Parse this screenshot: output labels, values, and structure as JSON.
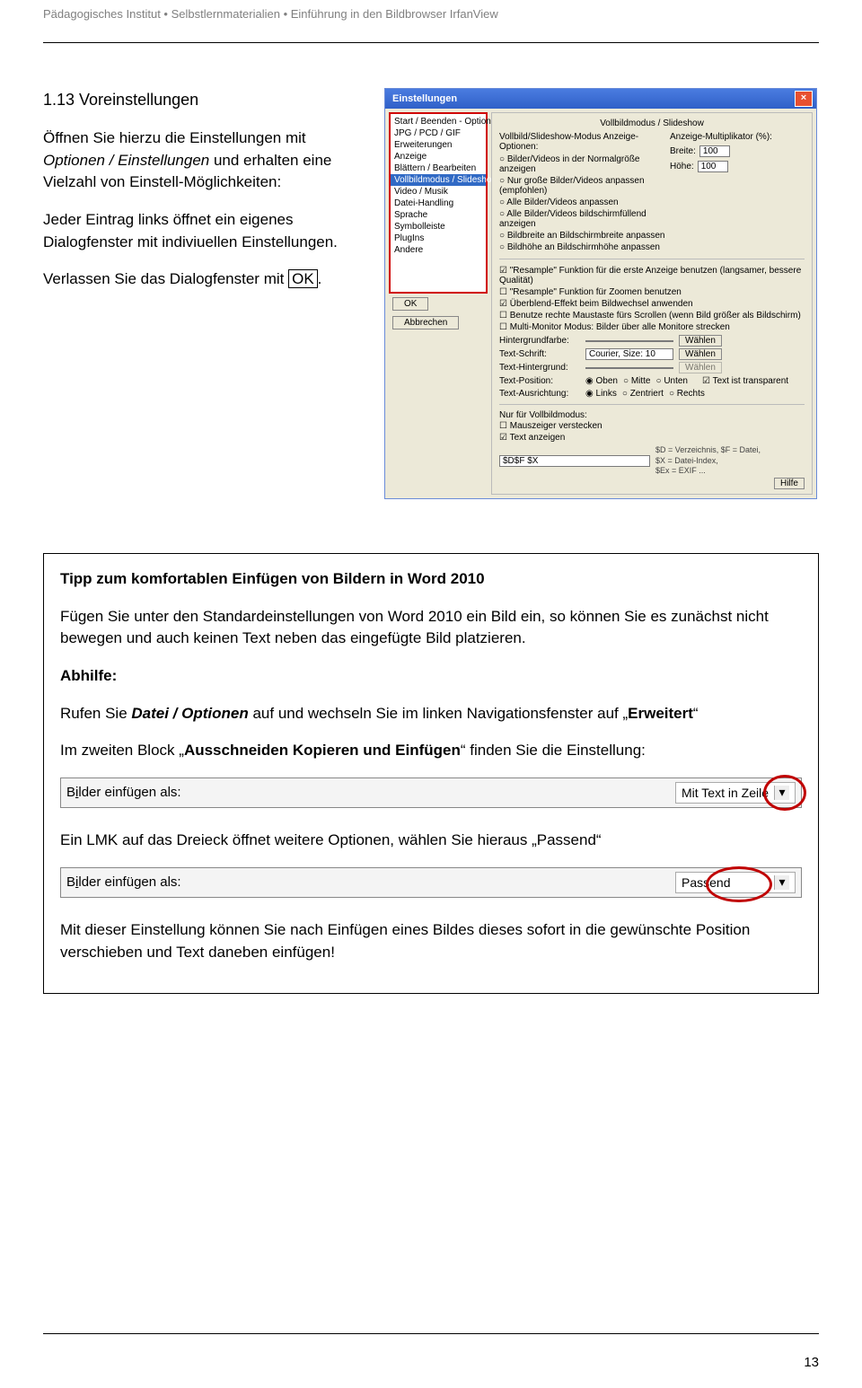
{
  "header": {
    "breadcrumb": "Pädagogisches Institut • Selbstlernmaterialien • Einführung in den Bildbrowser IrfanView"
  },
  "section": {
    "heading": "1.13 Voreinstellungen",
    "p1a": "Öffnen Sie hierzu die Einstellungen mit ",
    "p1b": "Optionen / Einstellungen",
    "p1c": " und erhalten eine Vielzahl von Einstell-Möglichkeiten:",
    "p2": "Jeder Eintrag links öffnet ein eigenes Dialogfenster mit indiviuellen Einstellungen.",
    "p3a": "Verlassen Sie das Dialogfenster mit ",
    "p3b": "OK",
    "p3c": "."
  },
  "dlg": {
    "title": "Einstellungen",
    "categories": [
      "Start / Beenden - Optionen",
      "JPG / PCD / GIF",
      "Erweiterungen",
      "Anzeige",
      "Blättern / Bearbeiten",
      "Vollbildmodus / Slideshow",
      "Video / Musik",
      "Datei-Handling",
      "Sprache",
      "Symbolleiste",
      "PlugIns",
      "Andere"
    ],
    "sel_index": 5,
    "ok": "OK",
    "cancel": "Abbrechen",
    "group": "Vollbildmodus / Slideshow",
    "left_hdr": "Vollbild/Slideshow-Modus Anzeige-Optionen:",
    "radios": [
      "Bilder/Videos in der Normalgröße anzeigen",
      "Nur große Bilder/Videos anpassen (empfohlen)",
      "Alle Bilder/Videos anpassen",
      "Alle Bilder/Videos bildschirmfüllend anzeigen",
      "Bildbreite an Bildschirmbreite anpassen",
      "Bildhöhe an Bildschirmhöhe anpassen"
    ],
    "right_hdr": "Anzeige-Multiplikator (%):",
    "breite_lbl": "Breite:",
    "breite_val": "100",
    "hoehe_lbl": "Höhe:",
    "hoehe_val": "100",
    "chk1": "\"Resample\" Funktion für die erste Anzeige benutzen (langsamer, bessere Qualität)",
    "chk2": "\"Resample\" Funktion für Zoomen benutzen",
    "chk3": "Überblend-Effekt beim Bildwechsel anwenden",
    "chk4": "Benutze rechte Maustaste fürs Scrollen (wenn Bild größer als Bildschirm)",
    "chk5": "Multi-Monitor Modus: Bilder über alle Monitore strecken",
    "hint_lbl": "Hintergrundfarbe:",
    "textschr_lbl": "Text-Schrift:",
    "textschr_val": "Courier, Size: 10",
    "texthint_lbl": "Text-Hintergrund:",
    "waehlen": "Wählen",
    "textpos_lbl": "Text-Position:",
    "tp1": "Oben",
    "tp2": "Mitte",
    "tp3": "Unten",
    "textaus_lbl": "Text-Ausrichtung:",
    "ta1": "Links",
    "ta2": "Zentriert",
    "ta3": "Rechts",
    "transparent": "Text ist transparent",
    "nur": "Nur für Vollbildmodus:",
    "mouse": "Mauszeiger verstecken",
    "showtext": "Text anzeigen",
    "pattern": "$D$F $X",
    "note": "$D = Verzeichnis, $F = Datei,\n$X = Datei-Index,\n$Ex = EXIF ...",
    "hilfe": "Hilfe"
  },
  "tip": {
    "title": "Tipp zum komfortablen Einfügen von Bildern in Word 2010",
    "p1": "Fügen Sie unter den Standardeinstellungen von Word 2010 ein Bild ein, so können Sie es zunächst nicht bewegen und auch keinen Text neben das eingefügte Bild platzieren.",
    "abhilfe": "Abhilfe:",
    "p2a": "Rufen Sie ",
    "p2b": "Datei / Optionen",
    "p2c": " auf und wechseln Sie im linken Navigationsfenster auf „",
    "p2d": "Erweitert",
    "p2e": "“",
    "p3a": "Im zweiten Block „",
    "p3b": "Ausschneiden Kopieren und Einfügen",
    "p3c": "“ finden Sie die Einstellung:",
    "row1_label": "Bilder einfügen als:",
    "row1_underline": "i",
    "row1_val": "Mit Text in Zeile",
    "p4": "Ein LMK auf das Dreieck öffnet weitere Optionen, wählen Sie hieraus „Passend“",
    "row2_label": "Bilder einfügen als:",
    "row2_val": "Passend",
    "p5": "Mit dieser Einstellung können Sie nach Einfügen eines Bildes dieses sofort in die gewünschte Position verschieben und Text daneben einfügen!"
  },
  "page_number": "13"
}
